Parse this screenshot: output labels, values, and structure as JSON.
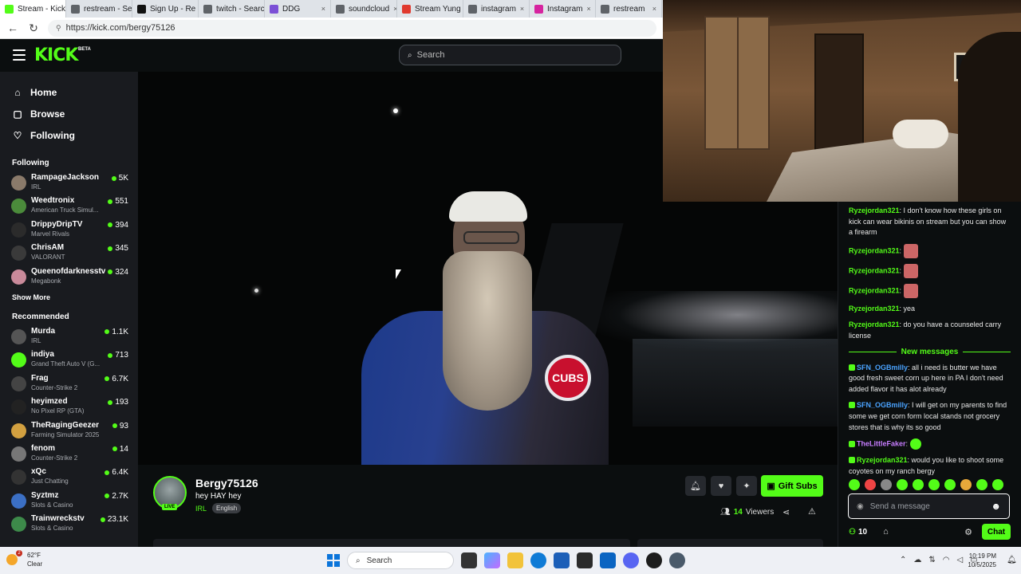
{
  "browser": {
    "tabs": [
      {
        "label": "Stream - Kick",
        "color": "#53fc18",
        "active": true
      },
      {
        "label": "restream - Search",
        "color": "#5f6368",
        "active": false
      },
      {
        "label": "Sign Up - Re",
        "color": "#111111",
        "active": false
      },
      {
        "label": "twitch - Search",
        "color": "#5f6368",
        "active": false
      },
      {
        "label": "DDG",
        "color": "#7b4fd6",
        "active": false
      },
      {
        "label": "soundcloud",
        "color": "#5f6368",
        "active": false
      },
      {
        "label": "Stream Yung",
        "color": "#e03a2f",
        "active": false
      },
      {
        "label": "instagram",
        "color": "#5f6368",
        "active": false
      },
      {
        "label": "Instagram",
        "color": "#d6249f",
        "active": false
      },
      {
        "label": "restream",
        "color": "#5f6368",
        "active": false
      }
    ],
    "url": "https://kick.com/bergy75126"
  },
  "header": {
    "logo": "KICK",
    "beta": "BETA",
    "search_placeholder": "Search"
  },
  "sidebar": {
    "nav": [
      {
        "label": "Home",
        "icon": "⌂"
      },
      {
        "label": "Browse",
        "icon": "▢"
      },
      {
        "label": "Following",
        "icon": "♡"
      }
    ],
    "following_title": "Following",
    "following": [
      {
        "name": "RampageJackson",
        "category": "IRL",
        "viewers": "5K",
        "color": "#8a7a6a"
      },
      {
        "name": "Weedtronix",
        "category": "American Truck Simul...",
        "viewers": "551",
        "color": "#4b8b3b"
      },
      {
        "name": "DrippyDripTV",
        "category": "Marvel Rivals",
        "viewers": "394",
        "color": "#2b2b2b"
      },
      {
        "name": "ChrisAM",
        "category": "VALORANT",
        "viewers": "345",
        "color": "#3a3a3a"
      },
      {
        "name": "Queenofdarknesstv",
        "category": "Megabonk",
        "viewers": "324",
        "color": "#c98a9a"
      }
    ],
    "show_more": "Show More",
    "recommended_title": "Recommended",
    "recommended": [
      {
        "name": "Murda",
        "category": "IRL",
        "viewers": "1.1K",
        "color": "#555555"
      },
      {
        "name": "indiya",
        "category": "Grand Theft Auto V (G...",
        "viewers": "713",
        "color": "#53fc18"
      },
      {
        "name": "Frag",
        "category": "Counter-Strike 2",
        "viewers": "6.7K",
        "color": "#444444"
      },
      {
        "name": "heyimzed",
        "category": "No Pixel RP (GTA)",
        "viewers": "193",
        "color": "#222222"
      },
      {
        "name": "TheRagingGeezer",
        "category": "Farming Simulator 2025",
        "viewers": "93",
        "color": "#d2a040"
      },
      {
        "name": "fenom",
        "category": "Counter-Strike 2",
        "viewers": "14",
        "color": "#777777"
      },
      {
        "name": "xQc",
        "category": "Just Chatting",
        "viewers": "6.4K",
        "color": "#333333"
      },
      {
        "name": "Syztmz",
        "category": "Slots & Casino",
        "viewers": "2.7K",
        "color": "#3b6fc4"
      },
      {
        "name": "Trainwreckstv",
        "category": "Slots & Casino",
        "viewers": "23.1K",
        "color": "#3d8a4a"
      }
    ]
  },
  "stream": {
    "username": "Bergy75126",
    "title": "hey HAY hey",
    "category": "IRL",
    "language": "English",
    "live_label": "LIVE",
    "viewers_count": "14",
    "viewers_label": "Viewers",
    "gift_label": "Gift Subs"
  },
  "chat": {
    "messages_before": [
      {
        "user": "Ryzejordan321",
        "text": "I don't know how these girls on kick can wear bikinis on stream but you can show a firearm",
        "color": "#53fc18",
        "emote": false
      },
      {
        "user": "Ryzejordan321",
        "text": "",
        "color": "#53fc18",
        "emote": true
      },
      {
        "user": "Ryzejordan321",
        "text": "",
        "color": "#53fc18",
        "emote": true
      },
      {
        "user": "Ryzejordan321",
        "text": "",
        "color": "#53fc18",
        "emote": true
      },
      {
        "user": "Ryzejordan321",
        "text": "yea",
        "color": "#53fc18",
        "emote": false
      },
      {
        "user": "Ryzejordan321",
        "text": "do you have a counseled carry license",
        "color": "#53fc18",
        "emote": false
      }
    ],
    "new_messages_label": "New messages",
    "messages_after": [
      {
        "user": "SFN_OGBmilly",
        "text": "all i need is butter we have good fresh sweet corn up here in PA I don't need added flavor it has alot already",
        "color": "#4aa3ff",
        "emote": false
      },
      {
        "user": "SFN_OGBmilly",
        "text": "I will get on my parents to find some we get corn form local stands not grocery stores that is why its so good",
        "color": "#4aa3ff",
        "emote": false
      },
      {
        "user": "TheLittleFaker",
        "text": "",
        "color": "#c77dff",
        "emote": true
      },
      {
        "user": "Ryzejordan321",
        "text": "would you like to shoot some coyotes on my ranch bergy",
        "color": "#53fc18",
        "emote": false
      }
    ],
    "input_placeholder": "Send a message",
    "points": "10",
    "chat_button": "Chat"
  },
  "taskbar": {
    "temperature": "62°F",
    "weather": "Clear",
    "weather_badge": "2",
    "search_label": "Search",
    "time": "10:19 PM",
    "date": "10/5/2025"
  }
}
